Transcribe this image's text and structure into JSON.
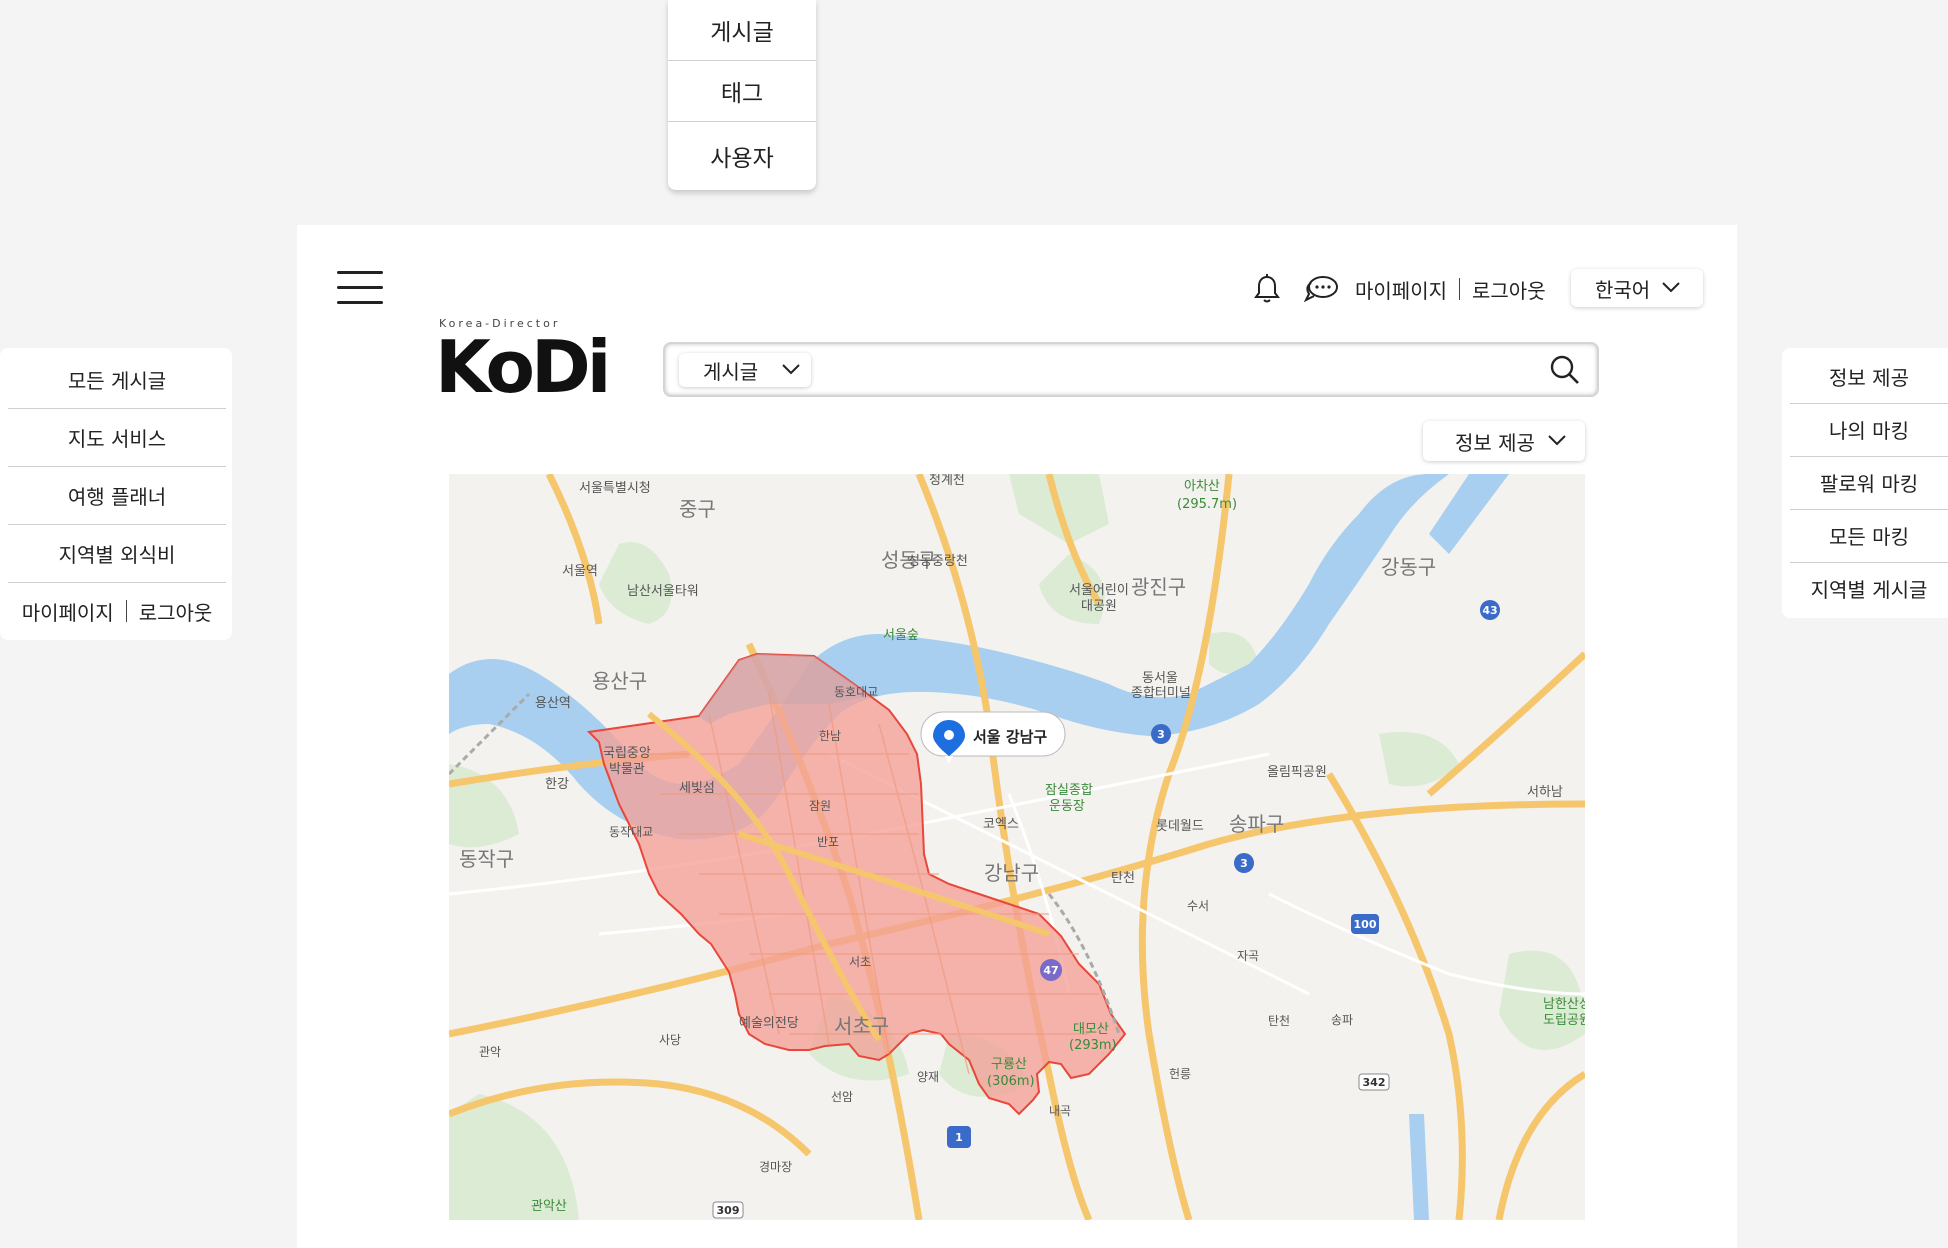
{
  "search_type_menu": {
    "items": [
      "게시글",
      "태그",
      "사용자"
    ]
  },
  "left_menu": {
    "items": [
      "모든 게시글",
      "지도 서비스",
      "여행 플래너",
      "지역별 외식비"
    ],
    "mypage": "마이페이지",
    "logout": "로그아웃"
  },
  "right_menu": {
    "items": [
      "정보 제공",
      "나의 마킹",
      "팔로워 마킹",
      "모든 마킹",
      "지역별 게시글"
    ]
  },
  "header": {
    "mypage": "마이페이지",
    "logout": "로그아웃",
    "language": "한국어",
    "bell_icon": "bell-icon",
    "chat_icon": "chat-icon"
  },
  "logo": {
    "tagline": "Korea-Director",
    "text": "KoDi"
  },
  "search": {
    "type": "게시글",
    "placeholder": "",
    "value": ""
  },
  "info_filter": "정보 제공",
  "map": {
    "marker_label": "서울 강남구",
    "highlight_color": "#f3a097",
    "labels": {
      "seoul_city_hall": "서울특별시청",
      "cheonggyecheon": "청계천",
      "jung_gu": "중구",
      "acha_mountain": "아차산",
      "acha_height": "(295.7m)",
      "seoul_station": "서울역",
      "namsan_tower": "남산서울타워",
      "seongdong": "성동구",
      "seongdong_road": "성동중랑천",
      "gwangjin": "광진구",
      "children_park": "서울어린이",
      "children_park2": "대공원",
      "gangdong": "강동구",
      "seoul_forest": "서울숲",
      "yongsan": "용산구",
      "yongsan_station": "용산역",
      "dong_seoul": "동서울",
      "terminal": "종합터미널",
      "national_museum": "국립중앙",
      "museum2": "박물관",
      "olympic_park": "올림픽공원",
      "hangang": "한강",
      "sebitseom": "세빛섬",
      "jamsil_sports": "잠실종합",
      "sports2": "운동장",
      "coex": "코엑스",
      "lotte_world": "롯데월드",
      "songpa": "송파구",
      "dongjak": "동작구",
      "gangnam": "강남구",
      "tancheon": "탄천",
      "arts_center": "예술의전당",
      "seocho": "서초구",
      "daemosan": "대모산",
      "daemo_height": "(293m)",
      "guryongsan": "구룡산",
      "guryong_height": "(306m)",
      "gwanaksan": "관악산",
      "namhansan": "남한산성",
      "namhan2": "도립공원",
      "ic_hannam": "한남",
      "ic_jamwon": "잠원",
      "ic_banpo": "반포",
      "ic_seocho": "서초",
      "ic_sadang": "사당",
      "ic_gwanak": "관악",
      "ic_yangjae": "양재",
      "ic_seonam": "선암",
      "ic_naegok": "내곡",
      "ic_heolleung": "헌릉",
      "ic_gyeongmajang": "경마장",
      "ic_susuh": "수서",
      "ic_jagok": "자곡",
      "ic_songpa": "송파",
      "ic_hanam": "서하남",
      "jc_dongho": "동호대교",
      "jc_dongjak": "동작대교",
      "jc_tancheon": "탄천",
      "route_1": "1",
      "route_3": "3",
      "route_3b": "3",
      "route_43": "43",
      "route_47": "47",
      "route_100": "100",
      "route_309": "309",
      "route_342": "342"
    }
  }
}
